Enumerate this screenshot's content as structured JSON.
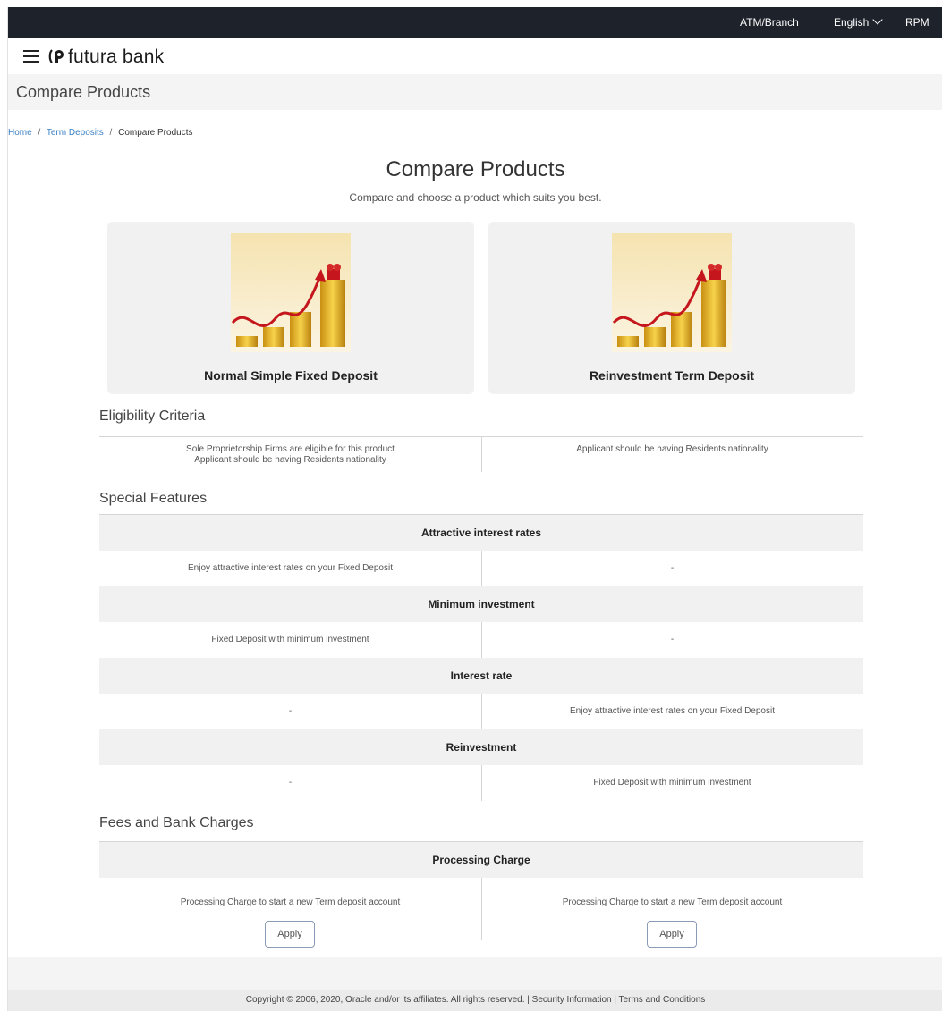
{
  "topbar": {
    "atm_branch": "ATM/Branch",
    "language": "English",
    "user": "RPM"
  },
  "brand": {
    "name": "futura bank"
  },
  "page_title": "Compare Products",
  "breadcrumb": {
    "home": "Home",
    "term_deposits": "Term Deposits",
    "current": "Compare Products",
    "separator": "/"
  },
  "hero": {
    "title": "Compare Products",
    "subtitle": "Compare and choose a product which suits you best."
  },
  "products": [
    {
      "name": "Normal Simple Fixed Deposit"
    },
    {
      "name": "Reinvestment Term Deposit"
    }
  ],
  "eligibility": {
    "title": "Eligibility Criteria",
    "left_line1": "Sole Proprietorship Firms are eligible for this product",
    "left_line2": "Applicant should be having Residents nationality",
    "right": "Applicant should be having Residents nationality"
  },
  "special_features": {
    "title": "Special Features",
    "rows": [
      {
        "heading": "Attractive interest rates",
        "left": "Enjoy attractive interest rates on your Fixed Deposit",
        "right": "-"
      },
      {
        "heading": "Minimum investment",
        "left": "Fixed Deposit with minimum investment",
        "right": "-"
      },
      {
        "heading": "Interest rate",
        "left": "-",
        "right": "Enjoy attractive interest rates on your Fixed Deposit"
      },
      {
        "heading": "Reinvestment",
        "left": "-",
        "right": "Fixed Deposit with minimum investment"
      }
    ]
  },
  "fees": {
    "title": "Fees and Bank Charges",
    "heading": "Processing Charge",
    "left": "Processing Charge to start a new Term deposit account",
    "right": "Processing Charge to start a new Term deposit account",
    "apply_label": "Apply"
  },
  "footer": {
    "text": "Copyright © 2006, 2020, Oracle and/or its affiliates. All rights reserved. | Security Information | Terms and Conditions"
  }
}
